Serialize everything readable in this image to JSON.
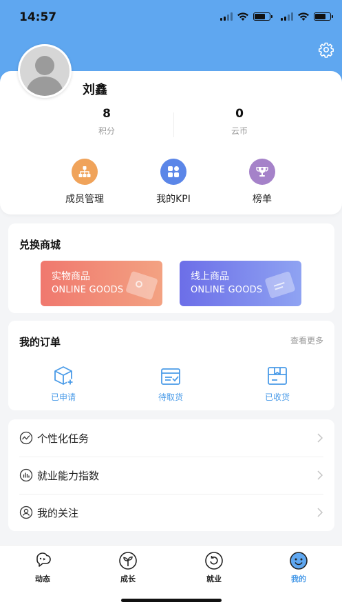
{
  "status_bar": {
    "time": "14:57"
  },
  "profile": {
    "name": "刘鑫",
    "stats": [
      {
        "value": "8",
        "label": "积分"
      },
      {
        "value": "0",
        "label": "云币"
      }
    ],
    "quick_actions": [
      {
        "label": "成员管理",
        "icon": "org-chart-icon",
        "color": "#f0a35a"
      },
      {
        "label": "我的KPI",
        "icon": "grid-icon",
        "color": "#5b86e8"
      },
      {
        "label": "榜单",
        "icon": "trophy-icon",
        "color": "#a582c9"
      }
    ]
  },
  "mall": {
    "title": "兑换商城",
    "buttons": [
      {
        "title": "实物商品",
        "subtitle": "ONLINE GOODS"
      },
      {
        "title": "线上商品",
        "subtitle": "ONLINE GOODS"
      }
    ]
  },
  "orders": {
    "title": "我的订单",
    "more": "查看更多",
    "items": [
      {
        "label": "已申请",
        "icon": "box-plus-icon"
      },
      {
        "label": "待取货",
        "icon": "pickup-box-icon"
      },
      {
        "label": "已收货",
        "icon": "received-box-icon"
      }
    ]
  },
  "menu": [
    {
      "label": "个性化任务",
      "icon": "trend-icon"
    },
    {
      "label": "就业能力指数",
      "icon": "bar-chart-icon"
    },
    {
      "label": "我的关注",
      "icon": "follow-icon"
    }
  ],
  "tabbar": [
    {
      "label": "动态",
      "icon": "dynamic-icon",
      "active": false
    },
    {
      "label": "成长",
      "icon": "sprout-icon",
      "active": false
    },
    {
      "label": "就业",
      "icon": "employment-icon",
      "active": false
    },
    {
      "label": "我的",
      "icon": "smile-icon",
      "active": true
    }
  ],
  "colors": {
    "header": "#5fa7f0",
    "accent": "#4a9be8"
  }
}
